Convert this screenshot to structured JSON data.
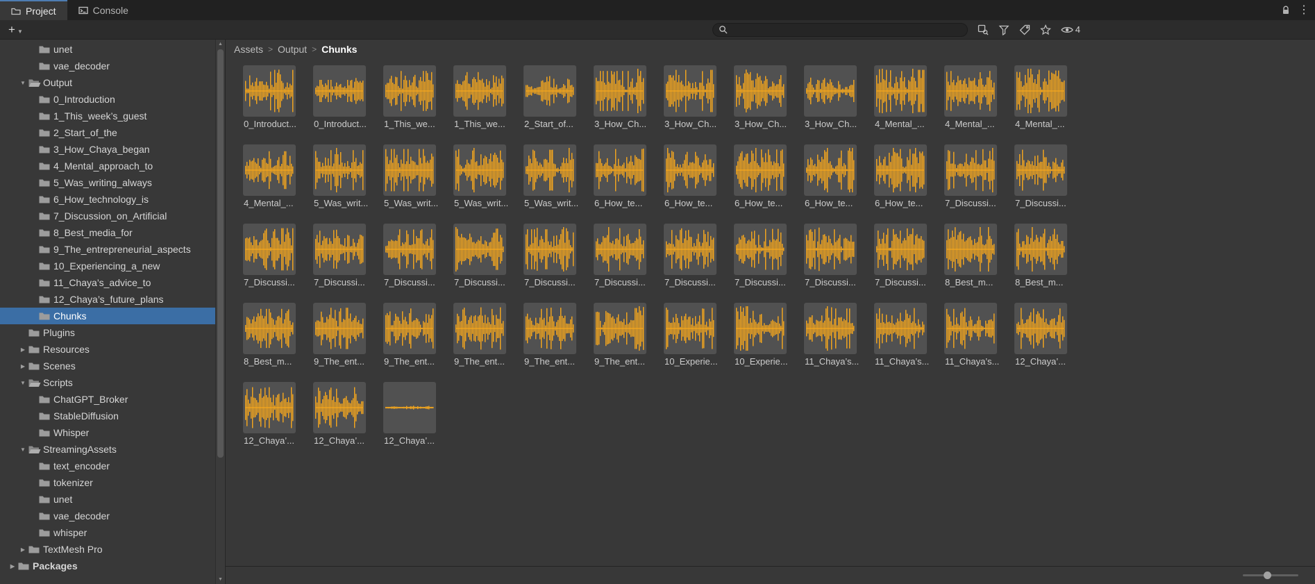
{
  "window": {
    "tabs": [
      {
        "label": "Project"
      },
      {
        "label": "Console"
      }
    ],
    "controls": [
      "lock-icon",
      "menu-icon"
    ]
  },
  "toolbar": {
    "create_button": "+",
    "search": {
      "placeholder": "",
      "value": ""
    },
    "right_icons": [
      "open-in-search",
      "search-by-type",
      "search-by-label",
      "favorites",
      "visibility"
    ],
    "hidden_count": "4"
  },
  "breadcrumb": {
    "items": [
      "Assets",
      "Output",
      "Chunks"
    ],
    "separator": ">"
  },
  "sidebar": {
    "items": [
      {
        "label": "unet",
        "depth": 2,
        "arrow": "none",
        "folder": "closed"
      },
      {
        "label": "vae_decoder",
        "depth": 2,
        "arrow": "none",
        "folder": "closed"
      },
      {
        "label": "Output",
        "depth": 1,
        "arrow": "open",
        "folder": "open"
      },
      {
        "label": "0_Introduction",
        "depth": 2,
        "arrow": "none",
        "folder": "closed"
      },
      {
        "label": "1_This_week’s_guest",
        "depth": 2,
        "arrow": "none",
        "folder": "closed"
      },
      {
        "label": "2_Start_of_the",
        "depth": 2,
        "arrow": "none",
        "folder": "closed"
      },
      {
        "label": "3_How_Chaya_began",
        "depth": 2,
        "arrow": "none",
        "folder": "closed"
      },
      {
        "label": "4_Mental_approach_to",
        "depth": 2,
        "arrow": "none",
        "folder": "closed"
      },
      {
        "label": "5_Was_writing_always",
        "depth": 2,
        "arrow": "none",
        "folder": "closed"
      },
      {
        "label": "6_How_technology_is",
        "depth": 2,
        "arrow": "none",
        "folder": "closed"
      },
      {
        "label": "7_Discussion_on_Artificial",
        "depth": 2,
        "arrow": "none",
        "folder": "closed"
      },
      {
        "label": "8_Best_media_for",
        "depth": 2,
        "arrow": "none",
        "folder": "closed"
      },
      {
        "label": "9_The_entrepreneurial_aspects",
        "depth": 2,
        "arrow": "none",
        "folder": "closed"
      },
      {
        "label": "10_Experiencing_a_new",
        "depth": 2,
        "arrow": "none",
        "folder": "closed"
      },
      {
        "label": "11_Chaya’s_advice_to",
        "depth": 2,
        "arrow": "none",
        "folder": "closed"
      },
      {
        "label": "12_Chaya’s_future_plans",
        "depth": 2,
        "arrow": "none",
        "folder": "closed"
      },
      {
        "label": "Chunks",
        "depth": 2,
        "arrow": "none",
        "folder": "closed",
        "selected": true
      },
      {
        "label": "Plugins",
        "depth": 1,
        "arrow": "none",
        "folder": "closed"
      },
      {
        "label": "Resources",
        "depth": 1,
        "arrow": "closed",
        "folder": "closed"
      },
      {
        "label": "Scenes",
        "depth": 1,
        "arrow": "closed",
        "folder": "closed"
      },
      {
        "label": "Scripts",
        "depth": 1,
        "arrow": "open",
        "folder": "open"
      },
      {
        "label": "ChatGPT_Broker",
        "depth": 2,
        "arrow": "none",
        "folder": "closed"
      },
      {
        "label": "StableDiffusion",
        "depth": 2,
        "arrow": "none",
        "folder": "closed"
      },
      {
        "label": "Whisper",
        "depth": 2,
        "arrow": "none",
        "folder": "closed"
      },
      {
        "label": "StreamingAssets",
        "depth": 1,
        "arrow": "open",
        "folder": "open"
      },
      {
        "label": "text_encoder",
        "depth": 2,
        "arrow": "none",
        "folder": "closed"
      },
      {
        "label": "tokenizer",
        "depth": 2,
        "arrow": "none",
        "folder": "closed"
      },
      {
        "label": "unet",
        "depth": 2,
        "arrow": "none",
        "folder": "closed"
      },
      {
        "label": "vae_decoder",
        "depth": 2,
        "arrow": "none",
        "folder": "closed"
      },
      {
        "label": "whisper",
        "depth": 2,
        "arrow": "none",
        "folder": "closed"
      },
      {
        "label": "TextMesh Pro",
        "depth": 1,
        "arrow": "closed",
        "folder": "closed"
      },
      {
        "label": "Packages",
        "depth": 0,
        "arrow": "closed",
        "folder": "closed",
        "bold": true
      }
    ]
  },
  "grid": {
    "items": [
      {
        "label": "0_Introduct...",
        "amp": 0.95
      },
      {
        "label": "0_Introduct...",
        "amp": 0.5
      },
      {
        "label": "1_This_we...",
        "amp": 0.9
      },
      {
        "label": "1_This_we...",
        "amp": 0.85
      },
      {
        "label": "2_Start_of...",
        "amp": 0.55
      },
      {
        "label": "3_How_Ch...",
        "amp": 0.9
      },
      {
        "label": "3_How_Ch...",
        "amp": 0.95
      },
      {
        "label": "3_How_Ch...",
        "amp": 0.85
      },
      {
        "label": "3_How_Ch...",
        "amp": 0.5
      },
      {
        "label": "4_Mental_...",
        "amp": 0.95
      },
      {
        "label": "4_Mental_...",
        "amp": 0.9
      },
      {
        "label": "4_Mental_...",
        "amp": 0.92
      },
      {
        "label": "4_Mental_...",
        "amp": 0.85
      },
      {
        "label": "5_Was_writ...",
        "amp": 0.9
      },
      {
        "label": "5_Was_writ...",
        "amp": 0.95
      },
      {
        "label": "5_Was_writ...",
        "amp": 0.88
      },
      {
        "label": "5_Was_writ...",
        "amp": 0.92
      },
      {
        "label": "6_How_te...",
        "amp": 0.95
      },
      {
        "label": "6_How_te...",
        "amp": 0.9
      },
      {
        "label": "6_How_te...",
        "amp": 0.93
      },
      {
        "label": "6_How_te...",
        "amp": 0.88
      },
      {
        "label": "6_How_te...",
        "amp": 0.95
      },
      {
        "label": "7_Discussi...",
        "amp": 0.9
      },
      {
        "label": "7_Discussi...",
        "amp": 0.92
      },
      {
        "label": "7_Discussi...",
        "amp": 0.95
      },
      {
        "label": "7_Discussi...",
        "amp": 0.88
      },
      {
        "label": "7_Discussi...",
        "amp": 0.9
      },
      {
        "label": "7_Discussi...",
        "amp": 0.93
      },
      {
        "label": "7_Discussi...",
        "amp": 0.9
      },
      {
        "label": "7_Discussi...",
        "amp": 0.95
      },
      {
        "label": "7_Discussi...",
        "amp": 0.87
      },
      {
        "label": "7_Discussi...",
        "amp": 0.92
      },
      {
        "label": "7_Discussi...",
        "amp": 0.9
      },
      {
        "label": "7_Discussi...",
        "amp": 0.94
      },
      {
        "label": "8_Best_m...",
        "amp": 0.9
      },
      {
        "label": "8_Best_m...",
        "amp": 0.92
      },
      {
        "label": "8_Best_m...",
        "amp": 0.88
      },
      {
        "label": "9_The_ent...",
        "amp": 0.93
      },
      {
        "label": "9_The_ent...",
        "amp": 0.9
      },
      {
        "label": "9_The_ent...",
        "amp": 0.95
      },
      {
        "label": "9_The_ent...",
        "amp": 0.88
      },
      {
        "label": "9_The_ent...",
        "amp": 0.92
      },
      {
        "label": "10_Experie...",
        "amp": 0.9
      },
      {
        "label": "10_Experie...",
        "amp": 0.93
      },
      {
        "label": "11_Chaya’s...",
        "amp": 0.9
      },
      {
        "label": "11_Chaya’s...",
        "amp": 0.92
      },
      {
        "label": "11_Chaya’s...",
        "amp": 0.88
      },
      {
        "label": "12_Chaya’...",
        "amp": 0.9
      },
      {
        "label": "12_Chaya’...",
        "amp": 0.92
      },
      {
        "label": "12_Chaya’...",
        "amp": 0.9
      },
      {
        "label": "12_Chaya’...",
        "amp": 0.07
      }
    ]
  },
  "colors": {
    "selection": "#3b6ea5",
    "waveform": "#f8a81c",
    "thumbnail_bg": "#515151"
  }
}
